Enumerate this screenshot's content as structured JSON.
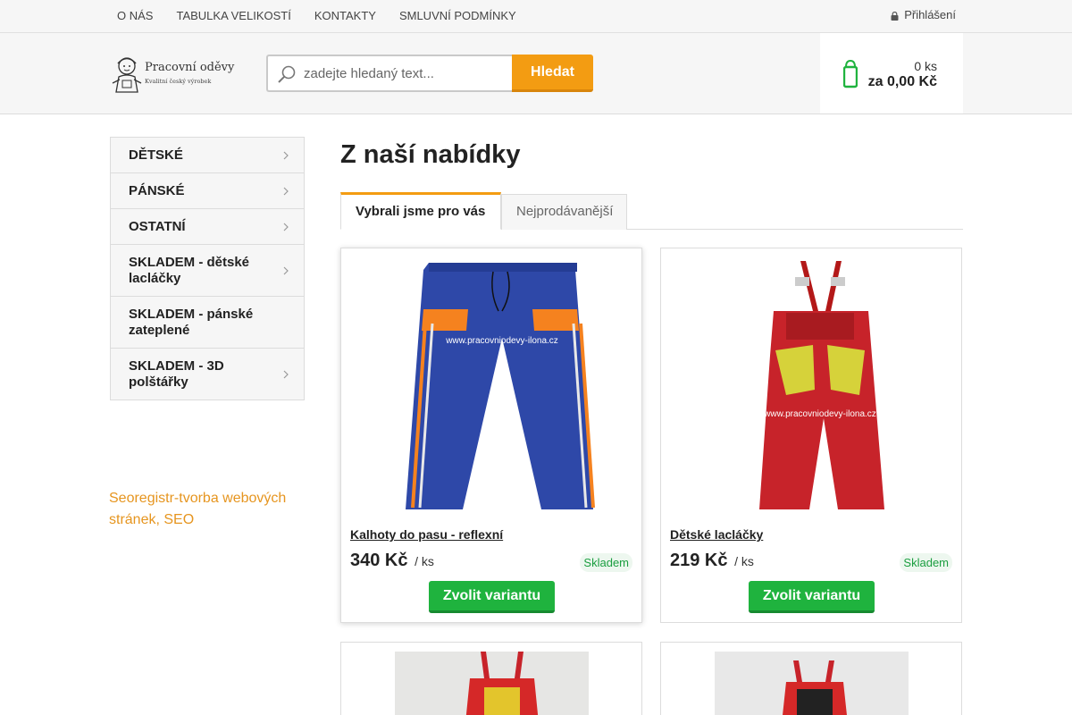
{
  "topnav": {
    "items": [
      "O NÁS",
      "TABULKA VELIKOSTÍ",
      "KONTAKTY",
      "SMLUVNÍ PODMÍNKY"
    ],
    "login_label": "Přihlášení"
  },
  "header": {
    "logo_name": "Pracovní oděvy",
    "logo_tagline": "Kvalitní český výrobek",
    "search_placeholder": "zadejte hledaný text...",
    "search_button": "Hledat",
    "cart_qty": "0 ks",
    "cart_total": "za 0,00 Kč"
  },
  "sidebar": {
    "items": [
      {
        "label": "DĚTSKÉ",
        "chevron": true
      },
      {
        "label": "PÁNSKÉ",
        "chevron": true
      },
      {
        "label": "OSTATNÍ",
        "chevron": true
      },
      {
        "label": "SKLADEM - dětské lacláčky",
        "chevron": true
      },
      {
        "label": "SKLADEM - pánské zateplené",
        "chevron": false
      },
      {
        "label": "SKLADEM - 3D polštářky",
        "chevron": true
      }
    ],
    "footer_link": "Seoregistr-tvorba webových stránek, SEO"
  },
  "main": {
    "title": "Z naší nabídky",
    "tabs": [
      "Vybrali jsme pro vás",
      "Nejprodávanější"
    ],
    "products": [
      {
        "name": "Kalhoty do pasu - reflexní",
        "price": "340 Kč",
        "unit": "/ ks",
        "stock": "Skladem",
        "button": "Zvolit variantu",
        "watermark": "www.pracovniodevy-ilona.cz"
      },
      {
        "name": "Dětské lacláčky",
        "price": "219 Kč",
        "unit": "/ ks",
        "stock": "Skladem",
        "button": "Zvolit variantu",
        "watermark": "www.pracovniodevy-ilona.cz"
      }
    ]
  },
  "colors": {
    "accent_orange": "#f39c12",
    "buy_green": "#1fb33e",
    "stock_green": "#1a9e3f",
    "link_orange": "#e6951f"
  }
}
